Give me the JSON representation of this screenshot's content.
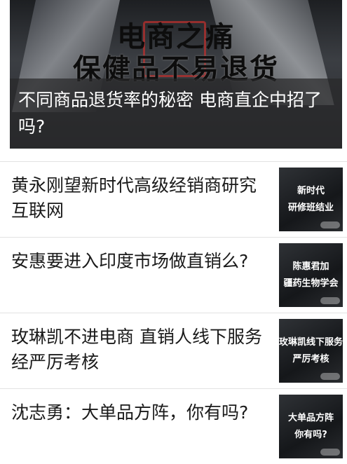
{
  "hero": {
    "banner_line1": "电商之痛",
    "banner_line2": "保健品不易退货",
    "caption": "不同商品退货率的秘密 电商直企中招了吗?"
  },
  "articles": [
    {
      "title": "黄永刚望新时代高级经销商研究互联网",
      "thumb_line1": "新时代",
      "thumb_line2": "研修班结业"
    },
    {
      "title": "安惠要进入印度市场做直销么?",
      "thumb_line1": "陈惠君加",
      "thumb_line2": "疆药生物学会"
    },
    {
      "title": "玫琳凯不进电商 直销人线下服务经严厉考核",
      "thumb_line1": "玫琳凯线下服务",
      "thumb_line2": "严厉考核"
    },
    {
      "title": "沈志勇：大单品方阵，你有吗?",
      "thumb_line1": "大单品方阵",
      "thumb_line2": "你有吗?"
    }
  ]
}
